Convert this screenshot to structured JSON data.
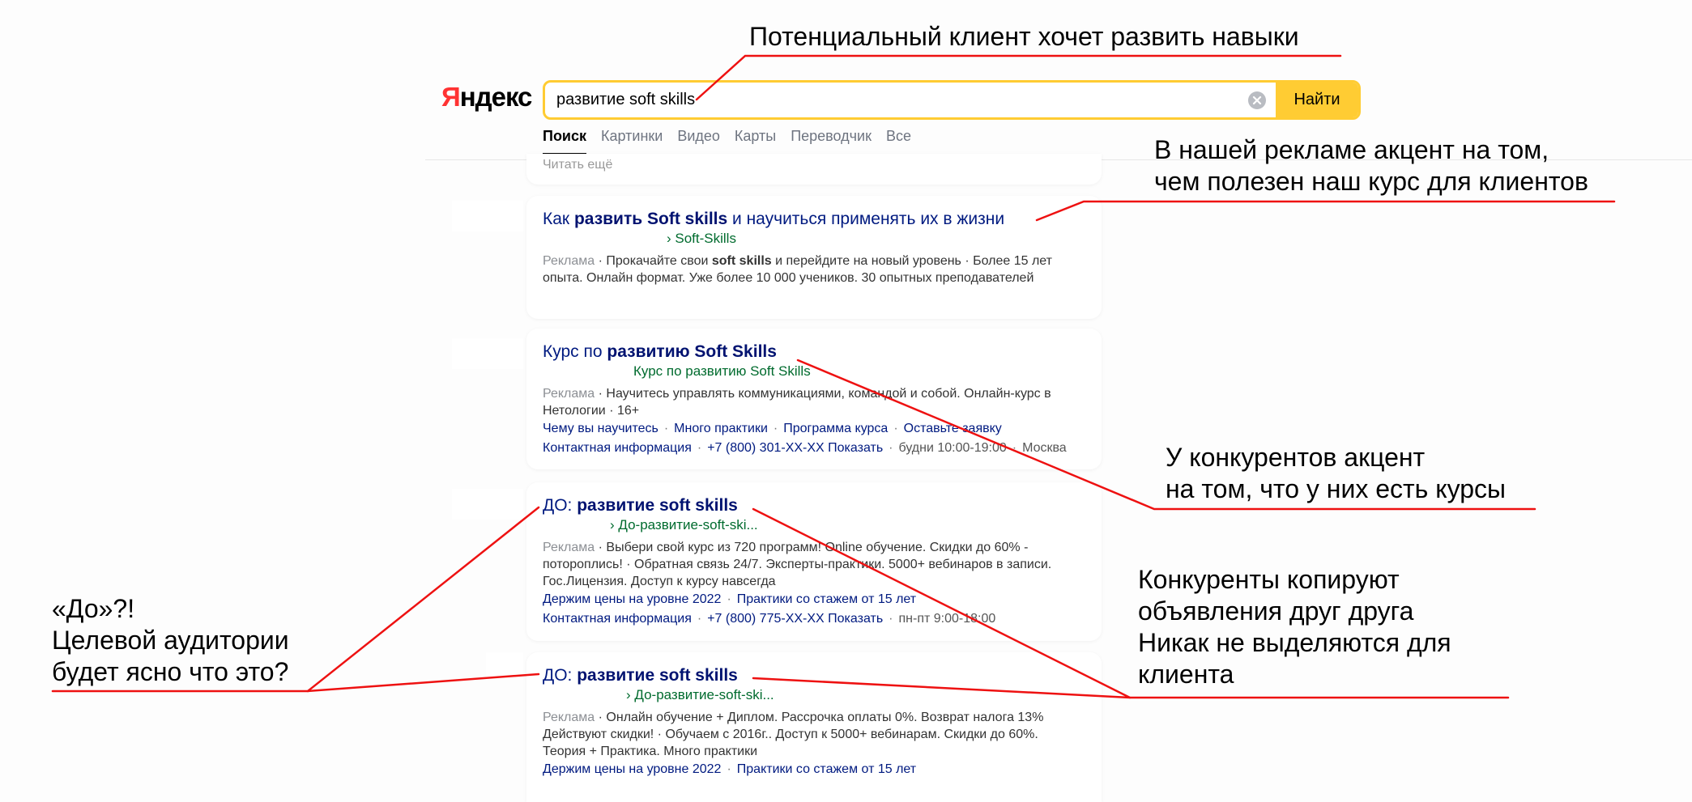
{
  "header": {
    "logo_first": "Я",
    "logo_rest": "ндекс",
    "search_value": "развитие soft skills",
    "search_button": "Найти"
  },
  "tabs": [
    "Поиск",
    "Картинки",
    "Видео",
    "Карты",
    "Переводчик",
    "Все"
  ],
  "read_more": "Читать ещё",
  "results": [
    {
      "title_pre": "Как ",
      "title_bold": "развить Soft skills",
      "title_post": " и научиться применять их в жизни",
      "url": "› Soft-Skills",
      "ad_label": "Реклама",
      "desc_1a": " · Прокачайте свои ",
      "desc_1b": "soft skills",
      "desc_1c": " и перейдите на новый уровень · Более 15 лет",
      "desc_2": "опыта. Онлайн формат. Уже более 10 000 учеников. 30 опытных преподавателей"
    },
    {
      "title_pre": "Курс по ",
      "title_bold": "развитию Soft Skills",
      "url": "Курс по развитию Soft Skills",
      "ad_label": "Реклама",
      "desc_1": " · Научитесь управлять коммуникациями, командой и собой. Онлайн-курс в",
      "desc_2": "Нетологии · 16+",
      "sitelinks": [
        "Чему вы научитесь",
        "Много практики",
        "Программа курса",
        "Оставьте заявку"
      ],
      "contact": "Контактная информация",
      "phone": "+7 (800) 301-XX-XX Показать",
      "hours": "будни 10:00-19:00",
      "city": "Москва"
    },
    {
      "title_pre": "ДО: ",
      "title_bold": "развитие soft skills",
      "url": "› До-развитие-soft-ski...",
      "ad_label": "Реклама",
      "desc_1": " · Выбери свой курс из 720 программ! Online обучение. Скидки до 60% -",
      "desc_2": "потороплись! · Обратная связь 24/7. Эксперты-практики. 5000+ вебинаров в записи.",
      "desc_3": "Гос.Лицензия. Доступ к курсу навсегда",
      "sitelinks": [
        "Держим цены на уровне 2022",
        "Практики со стажем от 15 лет"
      ],
      "contact": "Контактная информация",
      "phone": "+7 (800) 775-XX-XX Показать",
      "hours": "пн-пт 9:00-18:00"
    },
    {
      "title_pre": "ДО: ",
      "title_bold": "развитие soft skills",
      "url": "› До-развитие-soft-ski...",
      "ad_label": "Реклама",
      "desc_1": " · Онлайн обучение + Диплом. Рассрочка оплаты 0%. Возврат налога 13%",
      "desc_2": "Действуют скидки! · Обучаем с 2016г.. Доступ к 5000+ вебинарам. Скидки до 60%.",
      "desc_3": "Теория + Практика. Много практики",
      "sitelinks": [
        "Держим цены на уровне 2022",
        "Практики со стажем от 15 лет"
      ]
    }
  ],
  "annotations": {
    "top": "Потенциальный клиент хочет развить навыки",
    "ad_1": "В нашей рекламе акцент на том,",
    "ad_2": "чем полезен наш курс для клиентов",
    "comp_1": "У конкурентов акцент",
    "comp_2": "на том, что у них есть курсы",
    "copy_1": "Конкуренты копируют",
    "copy_2": "объявления друг друга",
    "copy_3": "Никак не выделяются для",
    "copy_4": "клиента",
    "do_1": "«До»?!",
    "do_2": "Целевой аудитории",
    "do_3": "будет ясно что это?"
  },
  "colors": {
    "accent_yellow": "#ffcc33",
    "annotation_red": "#ee1111",
    "link_blue": "#001a80",
    "url_green": "#006b2e"
  }
}
